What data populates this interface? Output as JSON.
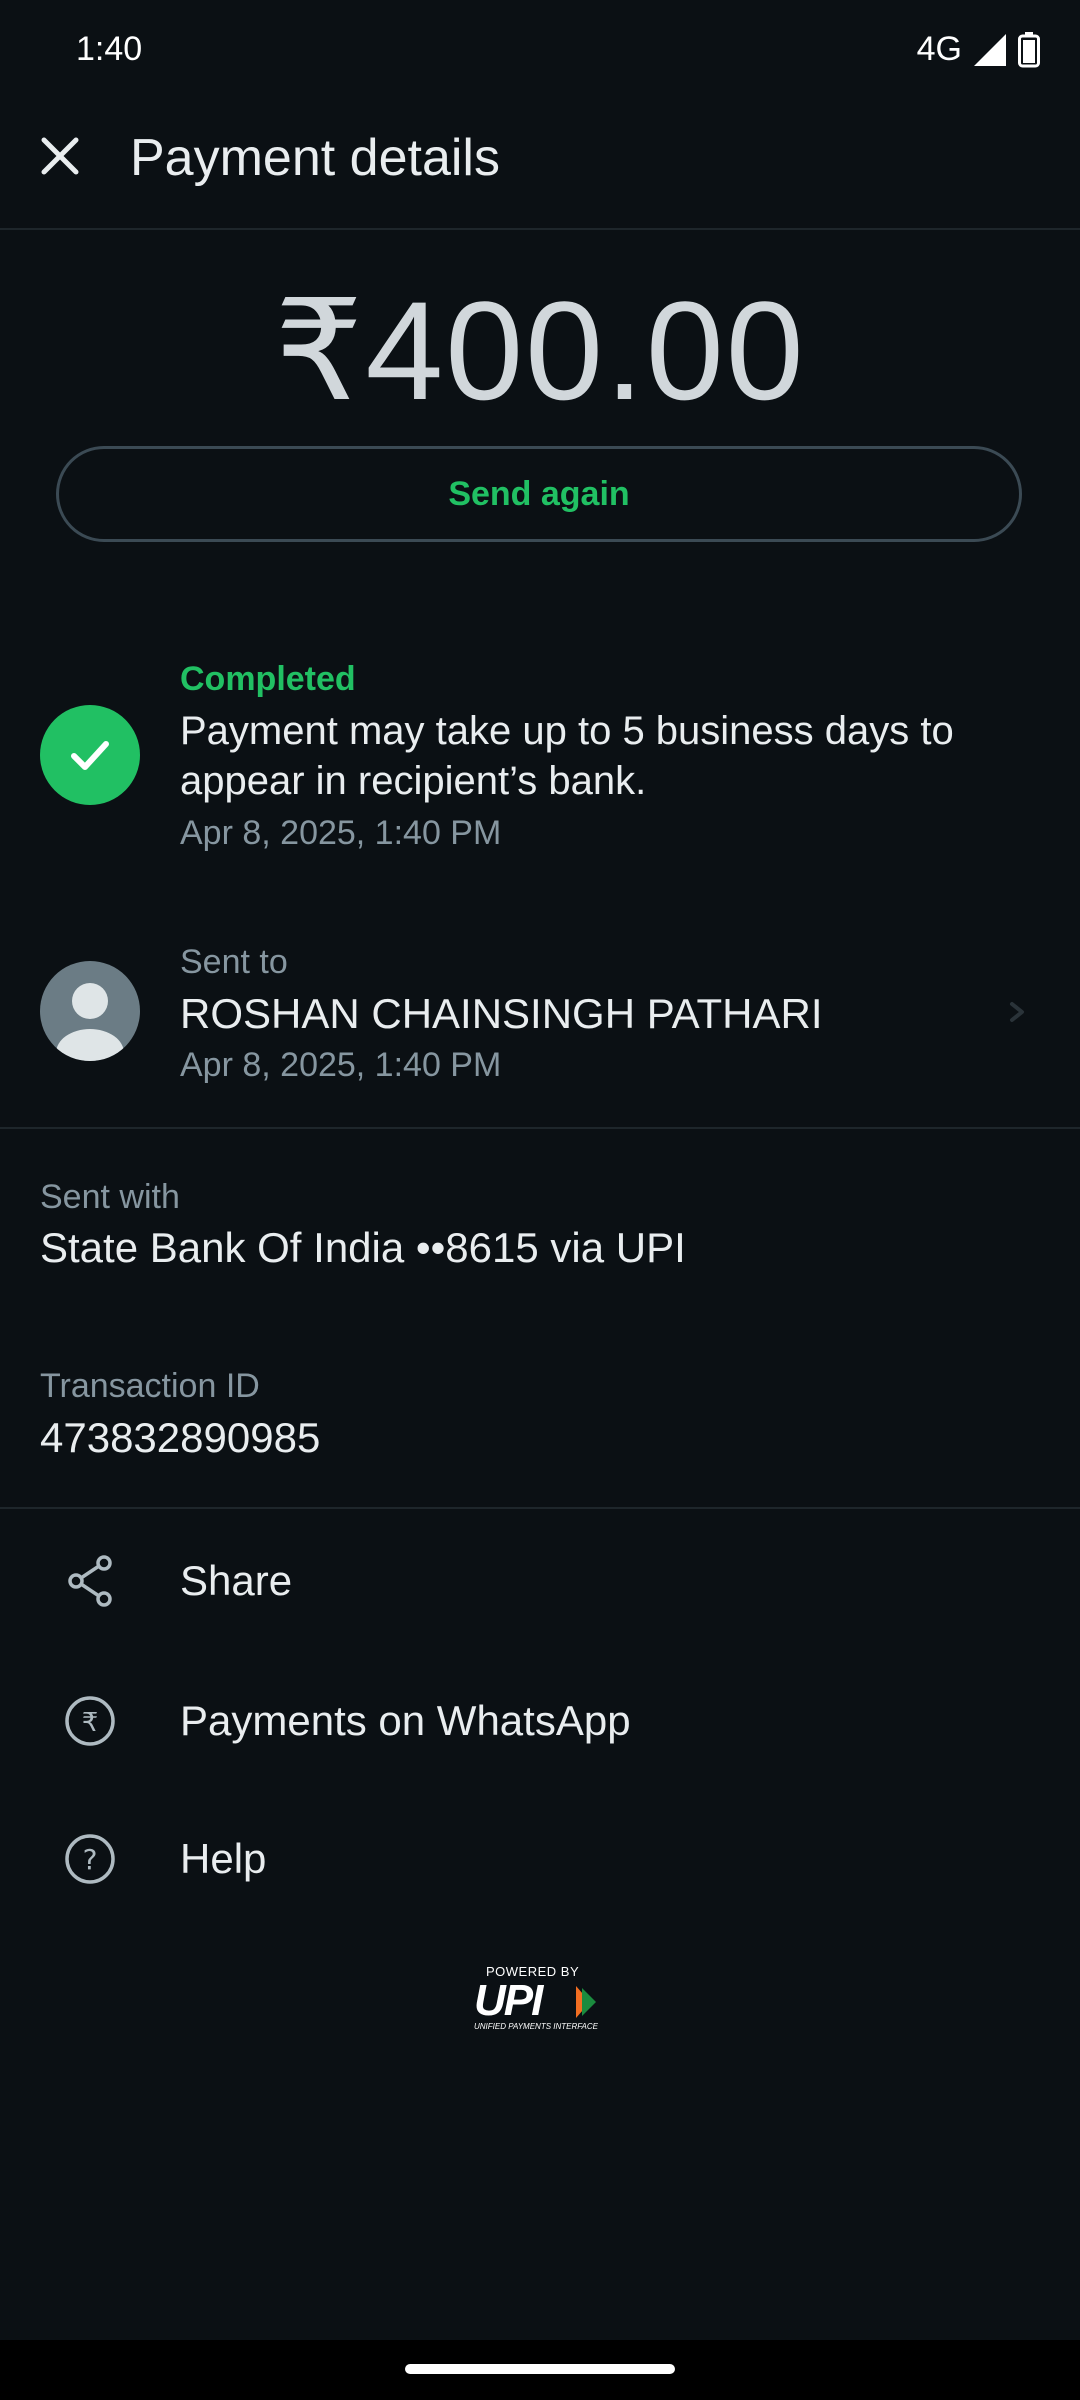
{
  "status_bar": {
    "time": "1:40",
    "network": "4G",
    "icons": [
      "signal-icon",
      "battery-icon"
    ]
  },
  "header": {
    "title": "Payment details",
    "close_icon": "close-icon"
  },
  "payment": {
    "amount": "₹400.00",
    "send_again_label": "Send again"
  },
  "status": {
    "label": "Completed",
    "message": "Payment may take up to 5 business days to appear in recipient’s bank.",
    "date": "Apr 8, 2025, 1:40 PM",
    "icon": "check-icon",
    "color": "#21c063"
  },
  "recipient": {
    "label": "Sent to",
    "name": "ROSHAN CHAINSINGH PATHARI",
    "date": "Apr 8, 2025, 1:40 PM",
    "icon": "avatar-icon"
  },
  "details": {
    "sent_with_label": "Sent with",
    "sent_with_value": "State Bank Of India ••8615 via UPI",
    "transaction_id_label": "Transaction ID",
    "transaction_id_value": "473832890985"
  },
  "actions": [
    {
      "label": "Share",
      "icon": "share-icon"
    },
    {
      "label": "Payments on WhatsApp",
      "icon": "rupee-icon"
    },
    {
      "label": "Help",
      "icon": "help-icon"
    }
  ],
  "footer": {
    "powered_by": "POWERED BY",
    "upi_text": "UPI",
    "upi_subtitle": "UNIFIED PAYMENTS INTERFACE"
  }
}
